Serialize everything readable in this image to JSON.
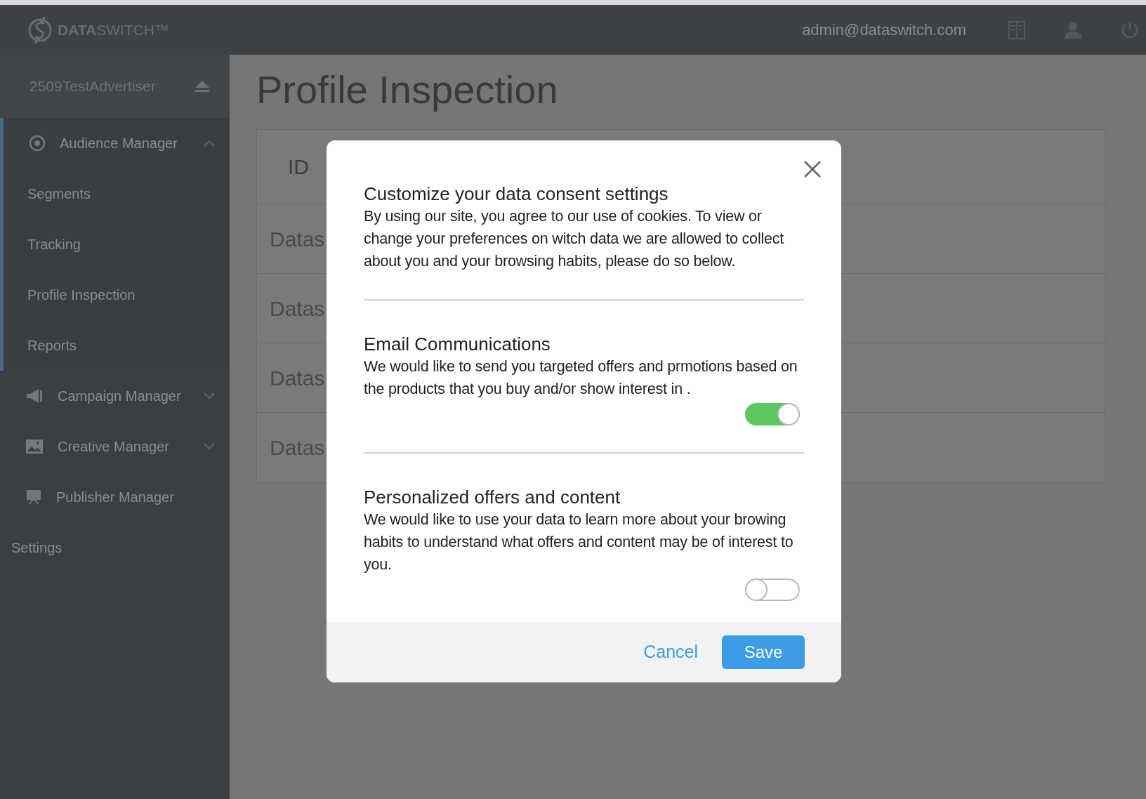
{
  "topbar": {
    "logo_bold": "DATA",
    "logo_light": "SWITCH™",
    "email": "admin@dataswitch.com"
  },
  "sidebar": {
    "account": "2509TestAdvertiser",
    "items": [
      {
        "label": "Audience Manager",
        "expanded": true,
        "children": [
          {
            "label": "Segments"
          },
          {
            "label": "Tracking"
          },
          {
            "label": "Profile Inspection"
          },
          {
            "label": "Reports"
          }
        ]
      },
      {
        "label": "Campaign Manager",
        "expanded": false
      },
      {
        "label": "Creative Manager",
        "expanded": false
      },
      {
        "label": "Publisher Manager"
      },
      {
        "label": "Settings"
      }
    ]
  },
  "page": {
    "title": "Profile Inspection"
  },
  "table": {
    "columns": [
      "ID"
    ],
    "rows": [
      [
        "Datas"
      ],
      [
        "Datas"
      ],
      [
        "Datas"
      ],
      [
        "Datas"
      ]
    ]
  },
  "dialog": {
    "sections": [
      {
        "title": "Customize your data consent settings",
        "text": "By using our site, you agree to our use of cookies. To view or change your preferences on witch data we are allowed to collect about you and your browsing habits, please do so below."
      },
      {
        "title": "Email Communications",
        "text": "We would like to send you targeted offers and prmotions based on the products that you buy and/or show interest in .",
        "toggle": {
          "on": true
        }
      },
      {
        "title": "Personalized offers and content",
        "text": "We would like to use your data to learn more about your browing habits to understand what offers and content may be of interest to you.",
        "toggle": {
          "on": false
        }
      }
    ],
    "buttons": [
      {
        "label": "Cancel",
        "kind": "link"
      },
      {
        "label": "Save",
        "kind": "primary"
      }
    ]
  }
}
